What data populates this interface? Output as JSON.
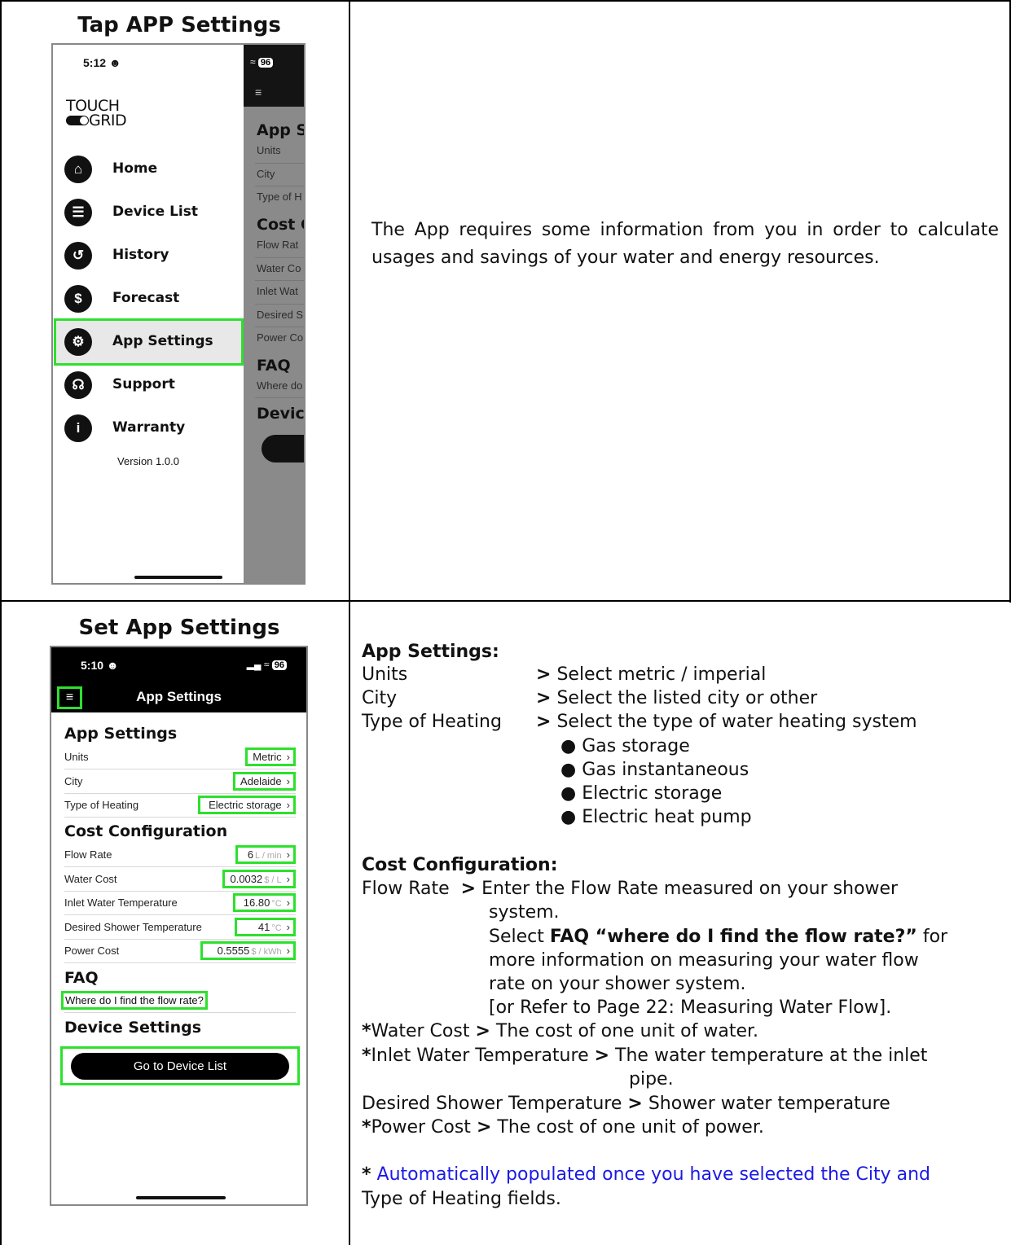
{
  "row1": {
    "caption": "Tap APP Settings",
    "phone": {
      "time": "5:12",
      "battery": "96",
      "logo_top": "TOUCH",
      "logo_bottom": "GRID",
      "menu": [
        {
          "label": "Home",
          "icon": "home-icon"
        },
        {
          "label": "Device List",
          "icon": "list-icon"
        },
        {
          "label": "History",
          "icon": "history-icon"
        },
        {
          "label": "Forecast",
          "icon": "dollar-icon"
        },
        {
          "label": "App Settings",
          "icon": "gear-icon"
        },
        {
          "label": "Support",
          "icon": "headset-icon"
        },
        {
          "label": "Warranty",
          "icon": "info-icon"
        }
      ],
      "version": "Version 1.0.0",
      "behind": {
        "h1": "App S",
        "i1": "Units",
        "i2": "City",
        "i3": "Type of H",
        "h2": "Cost C",
        "i4": "Flow Rat",
        "i5": "Water Co",
        "i6": "Inlet Wat",
        "i7": "Desired S",
        "i8": "Power Co",
        "h3": "FAQ",
        "i9": "Where do",
        "h4": "Devic"
      }
    },
    "description": "The App requires some information from you in order to calculate usages and savings of your water and energy resources."
  },
  "row2": {
    "caption": "Set App Settings",
    "phone": {
      "time": "5:10",
      "battery": "96",
      "title": "App Settings",
      "section_app": "App Settings",
      "units_label": "Units",
      "units_value": "Metric",
      "city_label": "City",
      "city_value": "Adelaide",
      "heating_label": "Type of Heating",
      "heating_value": "Electric storage",
      "section_cost": "Cost Configuration",
      "flow_label": "Flow Rate",
      "flow_value": "6",
      "flow_unit": "L / min",
      "water_label": "Water Cost",
      "water_value": "0.0032",
      "water_unit": "$ / L",
      "inlet_label": "Inlet Water Temperature",
      "inlet_value": "16.80",
      "inlet_unit": "°C",
      "desired_label": "Desired Shower Temperature",
      "desired_value": "41",
      "desired_unit": "°C",
      "power_label": "Power Cost",
      "power_value": "0.5555",
      "power_unit": "$ / kWh",
      "section_faq": "FAQ",
      "faq_item": "Where do I find the flow rate?",
      "section_device": "Device Settings",
      "go_button": "Go to Device List"
    },
    "text": {
      "app_heading": "App Settings:",
      "units": "Units",
      "units_desc": "Select metric / imperial",
      "city": "City",
      "city_desc": "Select the listed city or other",
      "heating": "Type of Heating",
      "heating_desc": "Select the type of water heating system",
      "bullets": [
        "Gas storage",
        "Gas instantaneous",
        "Electric storage",
        "Electric heat pump"
      ],
      "cost_heading": "Cost Configuration:",
      "flow": "Flow Rate",
      "flow_desc1": "Enter the Flow Rate measured on your shower",
      "flow_desc2": "system.",
      "faq_pre": "Select",
      "faq_bold": "FAQ “where do I find the flow rate?”",
      "faq_post": "for",
      "faq_line2": "more information on measuring your water flow",
      "faq_line3": "rate on your shower system.",
      "refer": "[or Refer to Page 22: Measuring Water Flow].",
      "water": "Water Cost",
      "water_desc": "The cost of one unit of water.",
      "inlet": "Inlet Water Temperature",
      "inlet_desc1": "The water temperature at the inlet",
      "inlet_desc2": "pipe.",
      "desired": "Desired Shower Temperature",
      "desired_desc": "Shower water temperature",
      "power": "Power Cost",
      "power_desc": "The cost of one unit of power.",
      "note1": "Automatically populated once you have selected the City and",
      "note2": "Type of Heating fields.",
      "star": "*",
      "arrow": ">"
    }
  }
}
